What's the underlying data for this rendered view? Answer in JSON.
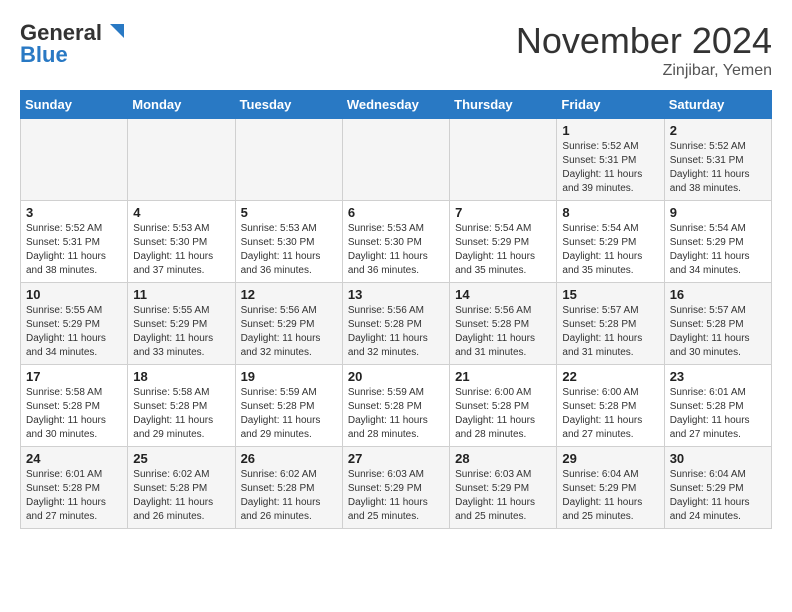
{
  "header": {
    "logo_general": "General",
    "logo_blue": "Blue",
    "month": "November 2024",
    "location": "Zinjibar, Yemen"
  },
  "weekdays": [
    "Sunday",
    "Monday",
    "Tuesday",
    "Wednesday",
    "Thursday",
    "Friday",
    "Saturday"
  ],
  "weeks": [
    [
      {
        "day": "",
        "info": ""
      },
      {
        "day": "",
        "info": ""
      },
      {
        "day": "",
        "info": ""
      },
      {
        "day": "",
        "info": ""
      },
      {
        "day": "",
        "info": ""
      },
      {
        "day": "1",
        "info": "Sunrise: 5:52 AM\nSunset: 5:31 PM\nDaylight: 11 hours\nand 39 minutes."
      },
      {
        "day": "2",
        "info": "Sunrise: 5:52 AM\nSunset: 5:31 PM\nDaylight: 11 hours\nand 38 minutes."
      }
    ],
    [
      {
        "day": "3",
        "info": "Sunrise: 5:52 AM\nSunset: 5:31 PM\nDaylight: 11 hours\nand 38 minutes."
      },
      {
        "day": "4",
        "info": "Sunrise: 5:53 AM\nSunset: 5:30 PM\nDaylight: 11 hours\nand 37 minutes."
      },
      {
        "day": "5",
        "info": "Sunrise: 5:53 AM\nSunset: 5:30 PM\nDaylight: 11 hours\nand 36 minutes."
      },
      {
        "day": "6",
        "info": "Sunrise: 5:53 AM\nSunset: 5:30 PM\nDaylight: 11 hours\nand 36 minutes."
      },
      {
        "day": "7",
        "info": "Sunrise: 5:54 AM\nSunset: 5:29 PM\nDaylight: 11 hours\nand 35 minutes."
      },
      {
        "day": "8",
        "info": "Sunrise: 5:54 AM\nSunset: 5:29 PM\nDaylight: 11 hours\nand 35 minutes."
      },
      {
        "day": "9",
        "info": "Sunrise: 5:54 AM\nSunset: 5:29 PM\nDaylight: 11 hours\nand 34 minutes."
      }
    ],
    [
      {
        "day": "10",
        "info": "Sunrise: 5:55 AM\nSunset: 5:29 PM\nDaylight: 11 hours\nand 34 minutes."
      },
      {
        "day": "11",
        "info": "Sunrise: 5:55 AM\nSunset: 5:29 PM\nDaylight: 11 hours\nand 33 minutes."
      },
      {
        "day": "12",
        "info": "Sunrise: 5:56 AM\nSunset: 5:29 PM\nDaylight: 11 hours\nand 32 minutes."
      },
      {
        "day": "13",
        "info": "Sunrise: 5:56 AM\nSunset: 5:28 PM\nDaylight: 11 hours\nand 32 minutes."
      },
      {
        "day": "14",
        "info": "Sunrise: 5:56 AM\nSunset: 5:28 PM\nDaylight: 11 hours\nand 31 minutes."
      },
      {
        "day": "15",
        "info": "Sunrise: 5:57 AM\nSunset: 5:28 PM\nDaylight: 11 hours\nand 31 minutes."
      },
      {
        "day": "16",
        "info": "Sunrise: 5:57 AM\nSunset: 5:28 PM\nDaylight: 11 hours\nand 30 minutes."
      }
    ],
    [
      {
        "day": "17",
        "info": "Sunrise: 5:58 AM\nSunset: 5:28 PM\nDaylight: 11 hours\nand 30 minutes."
      },
      {
        "day": "18",
        "info": "Sunrise: 5:58 AM\nSunset: 5:28 PM\nDaylight: 11 hours\nand 29 minutes."
      },
      {
        "day": "19",
        "info": "Sunrise: 5:59 AM\nSunset: 5:28 PM\nDaylight: 11 hours\nand 29 minutes."
      },
      {
        "day": "20",
        "info": "Sunrise: 5:59 AM\nSunset: 5:28 PM\nDaylight: 11 hours\nand 28 minutes."
      },
      {
        "day": "21",
        "info": "Sunrise: 6:00 AM\nSunset: 5:28 PM\nDaylight: 11 hours\nand 28 minutes."
      },
      {
        "day": "22",
        "info": "Sunrise: 6:00 AM\nSunset: 5:28 PM\nDaylight: 11 hours\nand 27 minutes."
      },
      {
        "day": "23",
        "info": "Sunrise: 6:01 AM\nSunset: 5:28 PM\nDaylight: 11 hours\nand 27 minutes."
      }
    ],
    [
      {
        "day": "24",
        "info": "Sunrise: 6:01 AM\nSunset: 5:28 PM\nDaylight: 11 hours\nand 27 minutes."
      },
      {
        "day": "25",
        "info": "Sunrise: 6:02 AM\nSunset: 5:28 PM\nDaylight: 11 hours\nand 26 minutes."
      },
      {
        "day": "26",
        "info": "Sunrise: 6:02 AM\nSunset: 5:28 PM\nDaylight: 11 hours\nand 26 minutes."
      },
      {
        "day": "27",
        "info": "Sunrise: 6:03 AM\nSunset: 5:29 PM\nDaylight: 11 hours\nand 25 minutes."
      },
      {
        "day": "28",
        "info": "Sunrise: 6:03 AM\nSunset: 5:29 PM\nDaylight: 11 hours\nand 25 minutes."
      },
      {
        "day": "29",
        "info": "Sunrise: 6:04 AM\nSunset: 5:29 PM\nDaylight: 11 hours\nand 25 minutes."
      },
      {
        "day": "30",
        "info": "Sunrise: 6:04 AM\nSunset: 5:29 PM\nDaylight: 11 hours\nand 24 minutes."
      }
    ]
  ]
}
